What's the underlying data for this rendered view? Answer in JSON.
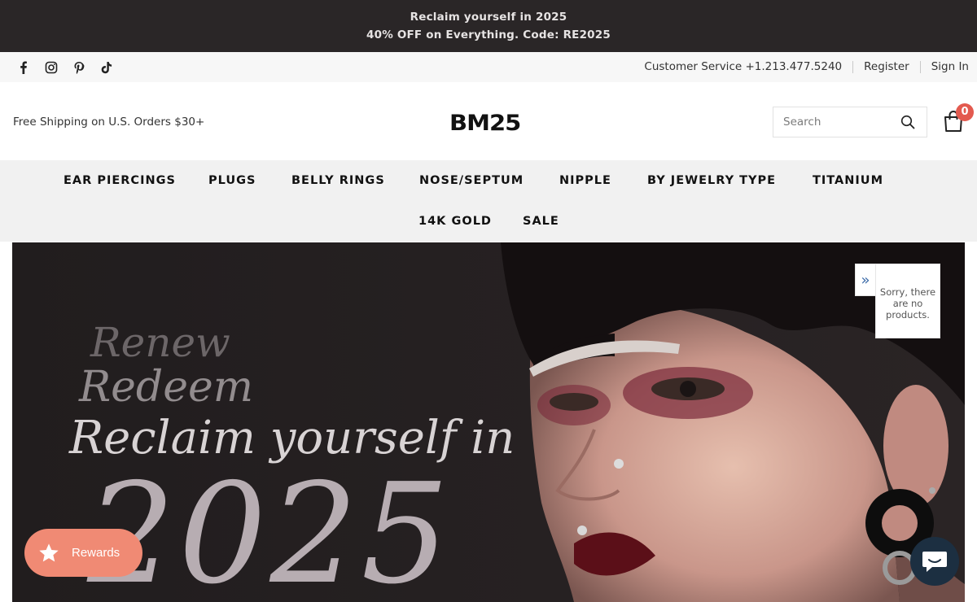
{
  "announcement": {
    "line1": "Reclaim yourself in 2025",
    "line2": "40% OFF on Everything. Code: RE2025"
  },
  "topbar": {
    "social_icons": [
      "facebook-icon",
      "instagram-icon",
      "pinterest-icon",
      "tiktok-icon"
    ],
    "customer_service": "Customer Service +1.213.477.5240",
    "register": "Register",
    "sign_in": "Sign In"
  },
  "header": {
    "shipping_note": "Free Shipping on U.S. Orders $30+",
    "logo": "BM25",
    "search_placeholder": "Search",
    "cart_count": "0"
  },
  "nav": {
    "items": [
      "EAR PIERCINGS",
      "PLUGS",
      "BELLY RINGS",
      "NOSE/SEPTUM",
      "NIPPLE",
      "BY JEWELRY TYPE",
      "TITANIUM",
      "14K GOLD",
      "SALE"
    ]
  },
  "hero": {
    "line1": "Renew",
    "line2": "Redeem",
    "line3": "Reclaim yourself in",
    "line4": "2025"
  },
  "popup": {
    "message": "Sorry, there are no products."
  },
  "rewards": {
    "label": "Rewards"
  },
  "colors": {
    "announcement_bg": "#2a2627",
    "rewards_bg": "#f08a74",
    "cart_badge": "#e35a4f",
    "chat_bg": "#1c2f41"
  }
}
